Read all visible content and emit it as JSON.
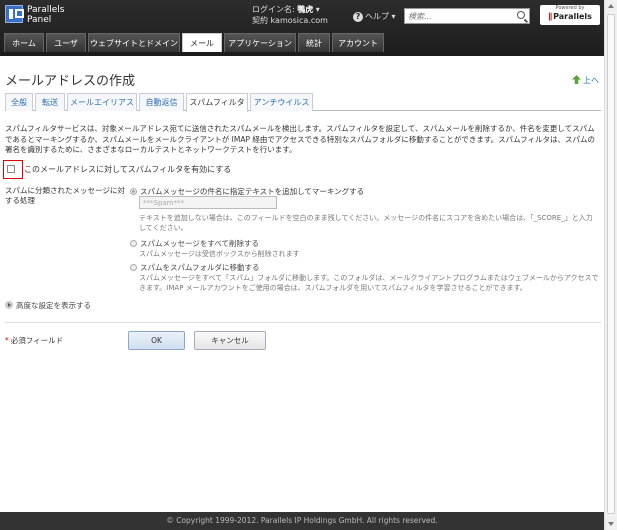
{
  "header": {
    "logo_line1": "Parallels",
    "logo_line2": "Panel",
    "login_label": "ログイン名:",
    "login_user": "鴨虎",
    "contract_label": "契約",
    "contract_name": "kamosica.com",
    "help_label": "ヘルプ",
    "search_placeholder": "検索...",
    "powered_small": "Powered by",
    "powered_brand": "Parallels"
  },
  "nav": {
    "tabs": [
      {
        "label": "ホーム"
      },
      {
        "label": "ユーザ"
      },
      {
        "label": "ウェブサイトとドメイン"
      },
      {
        "label": "メール"
      },
      {
        "label": "アプリケーション"
      },
      {
        "label": "統計"
      },
      {
        "label": "アカウント"
      }
    ]
  },
  "page": {
    "title": "メールアドレスの作成",
    "up_link": "上へ"
  },
  "subtabs": [
    {
      "label": "全般"
    },
    {
      "label": "転送"
    },
    {
      "label": "メールエイリアス"
    },
    {
      "label": "自動返信"
    },
    {
      "label": "スパムフィルタ"
    },
    {
      "label": "アンチウイルス"
    }
  ],
  "content": {
    "description": "スパムフィルタサービスは、対象メールアドレス宛てに送信されたスパムメールを検出します。スパムフィルタを設定して、スパムメールを削除するか、件名を変更してスパムであるとマーキングするか、スパムメールをメールクライアントが IMAP 経由でアクセスできる特別なスパムフォルダに移動することができます。スパムフィルタは、スパムの署名を識別するために、さまざまなローカルテストとネットワークテストを行います。",
    "enable_label": "このメールアドレスに対してスパムフィルタを有効にする",
    "field_label": "スパムに分類されたメッセージに対する処理",
    "opt1_label": "スパムメッセージの件名に指定テキストを追加してマーキングする",
    "opt1_value": "***Spam***",
    "opt1_hint": "テキストを追加しない場合は、このフィールドを空白のまま残してください。メッセージの件名にスコアを含めたい場合は、「_SCORE_」と入力してください。",
    "opt2_label": "スパムメッセージをすべて削除する",
    "opt2_hint": "スパムメッセージは受信ボックスから削除されます",
    "opt3_label": "スパムをスパムフォルダに移動する",
    "opt3_hint": "スパムメッセージをすべて「スパム」フォルダに移動します。このフォルダは、メールクライアントプログラムまたはウェブメールからアクセスできます。IMAP メールアカウントをご使用の場合は、スパムフォルダを用いてスパムフィルタを学習させることができます。",
    "advanced_label": "高度な設定を表示する",
    "required_label": "必須フィールド",
    "ok_label": "OK",
    "cancel_label": "キャンセル"
  },
  "footer": {
    "copyright": "© Copyright 1999-2012. Parallels IP Holdings GmbH. All rights reserved."
  }
}
